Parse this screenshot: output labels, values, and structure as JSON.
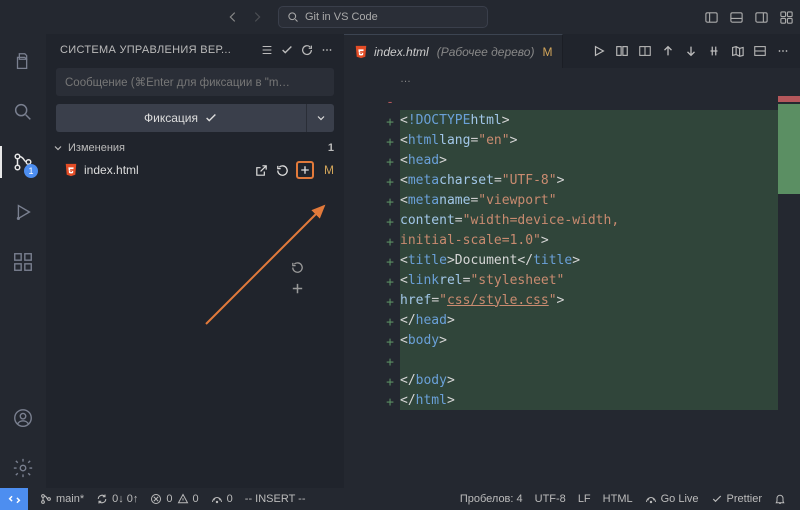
{
  "titlebar": {
    "search_placeholder": "Git in VS Code"
  },
  "activitybar": {
    "scm_badge": "1"
  },
  "scm": {
    "panel_title": "СИСТЕМА УПРАВЛЕНИЯ ВЕР...",
    "commit_placeholder": "Сообщение (⌘Enter для фиксации в \"m…",
    "commit_button": "Фиксация",
    "changes_label": "Изменения",
    "changes_count": "1",
    "file": {
      "name": "index.html",
      "status": "M"
    }
  },
  "tab": {
    "name": "index.html",
    "suffix": "(Рабочее дерево)",
    "status": "M"
  },
  "breadcrumb": "…",
  "code_lines": [
    {
      "sign": "-",
      "add": false,
      "html": ""
    },
    {
      "sign": "+",
      "add": true,
      "html": "<span class='txt'>&lt;</span><span class='doct'>!DOCTYPE</span> <span class='attr'>html</span><span class='txt'>&gt;</span>"
    },
    {
      "sign": "+",
      "add": true,
      "html": "<span class='txt'>&lt;</span><span class='tag'>html</span> <span class='attr'>lang</span>=<span class='str'>\"en\"</span><span class='txt'>&gt;</span>"
    },
    {
      "sign": "+",
      "add": true,
      "html": "<span class='txt'>&lt;</span><span class='tag'>head</span><span class='txt'>&gt;</span>"
    },
    {
      "sign": "+",
      "add": true,
      "html": "    <span class='txt'>&lt;</span><span class='tag'>meta</span> <span class='attr'>charset</span>=<span class='str'>\"UTF-8\"</span><span class='txt'>&gt;</span>"
    },
    {
      "sign": "+",
      "add": true,
      "html": "    <span class='txt'>&lt;</span><span class='tag'>meta</span> <span class='attr'>name</span>=<span class='str'>\"viewport\"</span>"
    },
    {
      "sign": "+",
      "add": true,
      "html": "    <span class='attr'>content</span>=<span class='str'>\"width=device-width,</span>"
    },
    {
      "sign": "+",
      "add": true,
      "html": "    <span class='str'>initial-scale=1.0\"</span><span class='txt'>&gt;</span>"
    },
    {
      "sign": "+",
      "add": true,
      "html": "    <span class='txt'>&lt;</span><span class='tag'>title</span><span class='txt'>&gt;Document&lt;/</span><span class='tag'>title</span><span class='txt'>&gt;</span>"
    },
    {
      "sign": "+",
      "add": true,
      "html": "    <span class='txt'>&lt;</span><span class='tag'>link</span> <span class='attr'>rel</span>=<span class='str'>\"stylesheet\"</span>"
    },
    {
      "sign": "+",
      "add": true,
      "html": "    <span class='attr'>href</span>=<span class='str'>\"<span class='underline'>css/style.css</span>\"</span><span class='txt'>&gt;</span>"
    },
    {
      "sign": "+",
      "add": true,
      "html": "<span class='txt'>&lt;/</span><span class='tag'>head</span><span class='txt'>&gt;</span>"
    },
    {
      "sign": "+",
      "add": true,
      "html": "<span class='txt'>&lt;</span><span class='tag'>body</span><span class='txt'>&gt;</span>"
    },
    {
      "sign": "+",
      "add": true,
      "html": ""
    },
    {
      "sign": "+",
      "add": true,
      "html": "<span class='txt'>&lt;/</span><span class='tag'>body</span><span class='txt'>&gt;</span>"
    },
    {
      "sign": "+",
      "add": true,
      "html": "<span class='txt'>&lt;/</span><span class='tag'>html</span><span class='txt'>&gt;</span>"
    }
  ],
  "statusbar": {
    "branch": "main*",
    "sync": "0↓ 0↑",
    "errors": "0",
    "warnings": "0",
    "radio": "0",
    "mode": "-- INSERT --",
    "spaces": "Пробелов: 4",
    "encoding": "UTF-8",
    "eol": "LF",
    "lang": "HTML",
    "golive": "Go Live",
    "prettier": "Prettier"
  }
}
